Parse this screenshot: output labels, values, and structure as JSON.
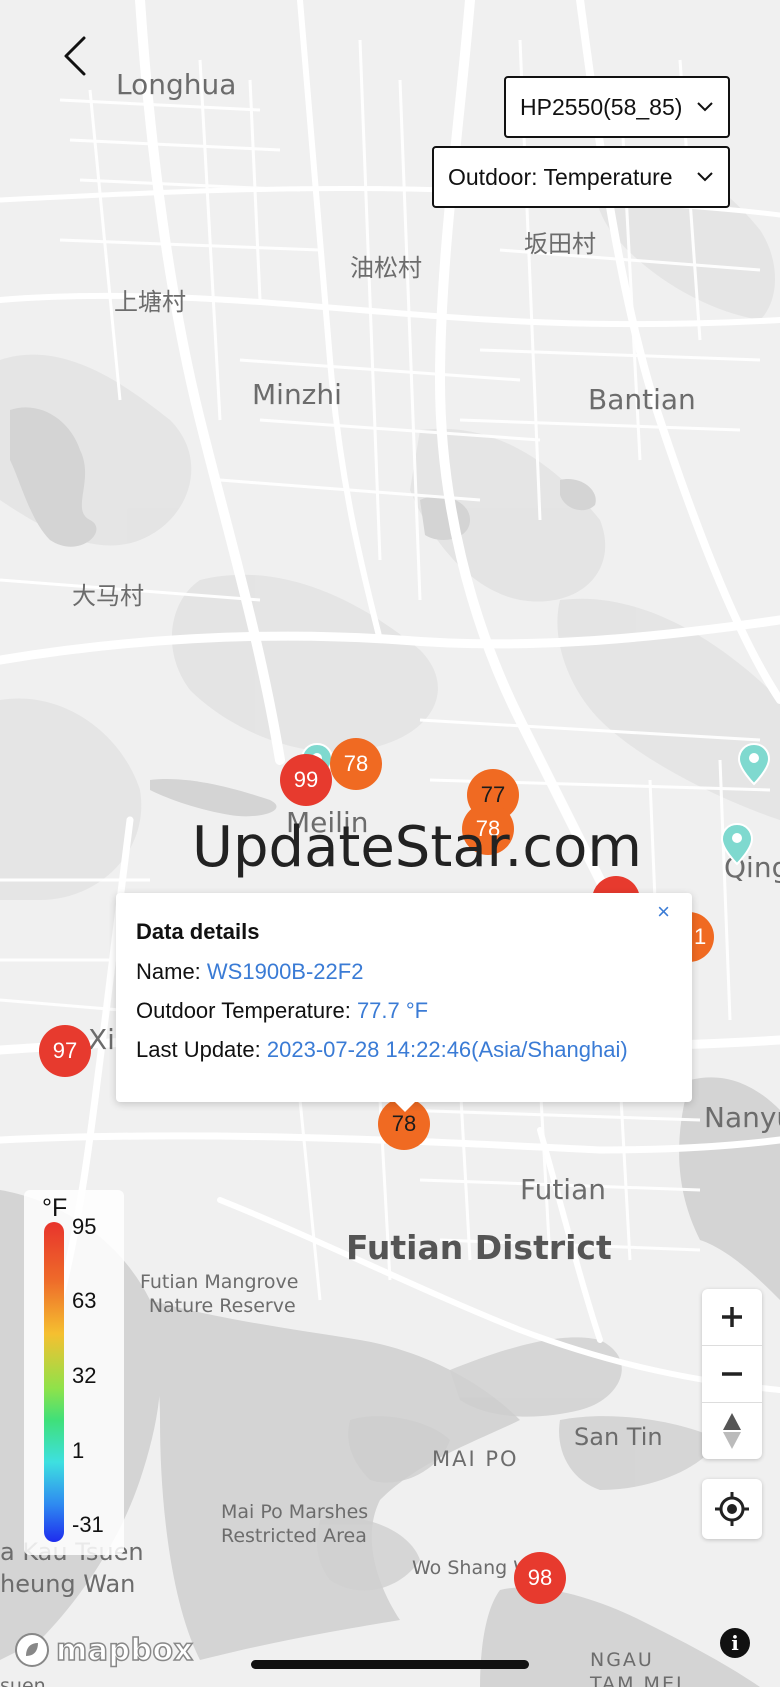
{
  "header": {
    "back_icon": "chevron-left-icon",
    "device_select": "HP2550(58_85)",
    "data_select": "Outdoor: Temperature"
  },
  "map_labels": {
    "longhua": "Longhua",
    "minzhi": "Minzhi",
    "bantian": "Bantian",
    "meilin": "Meilin",
    "futian": "Futian",
    "futian_district": "Futian District",
    "nanyu": "Nanyu",
    "qing": "Qing",
    "xi": "Xi",
    "youssongcun": "油松村",
    "bantiancun": "坂田村",
    "shangtangcun": "上塘村",
    "damacun": "大马村",
    "mangrove_1": "Futian Mangrove",
    "mangrove_2": "Nature Reserve",
    "san_tin": "San Tin",
    "mai_po": "MAI PO",
    "marshes_1": "Mai Po Marshes",
    "marshes_2": "Restricted Area",
    "wo_shang": "Wo Shang W",
    "kau_tsuen": "a Kau Tsuen",
    "heung_wan": "heung Wan",
    "ngau": "NGAU",
    "tam_mei": "TAM MEI",
    "suen": "suen"
  },
  "markers": {
    "m1": "99",
    "m2": "78",
    "m3": "77",
    "m4": "78",
    "m5": "97",
    "m6": "78",
    "m7": "98",
    "m8": "1"
  },
  "watermark": "UpdateStar.com",
  "popup": {
    "title": "Data details",
    "close": "×",
    "name_label": "Name: ",
    "name_value": "WS1900B-22F2",
    "temp_label": "Outdoor Temperature: ",
    "temp_value": "77.7 °F",
    "update_label": "Last Update: ",
    "update_value": "2023-07-28 14:22:46(Asia/Shanghai)"
  },
  "legend": {
    "unit": "°F",
    "ticks": [
      "95",
      "63",
      "32",
      "1",
      "-31"
    ]
  },
  "controls": {
    "zoom_in": "plus-icon",
    "zoom_out": "minus-icon",
    "compass": "compass-icon",
    "locate": "locate-icon",
    "info": "i"
  },
  "attribution": {
    "logo": "mapbox"
  },
  "colors": {
    "marker_orange": "#f06a22",
    "marker_red": "#e73a2e",
    "link_blue": "#3a7bd5",
    "pin_teal": "#7fd9cf"
  }
}
